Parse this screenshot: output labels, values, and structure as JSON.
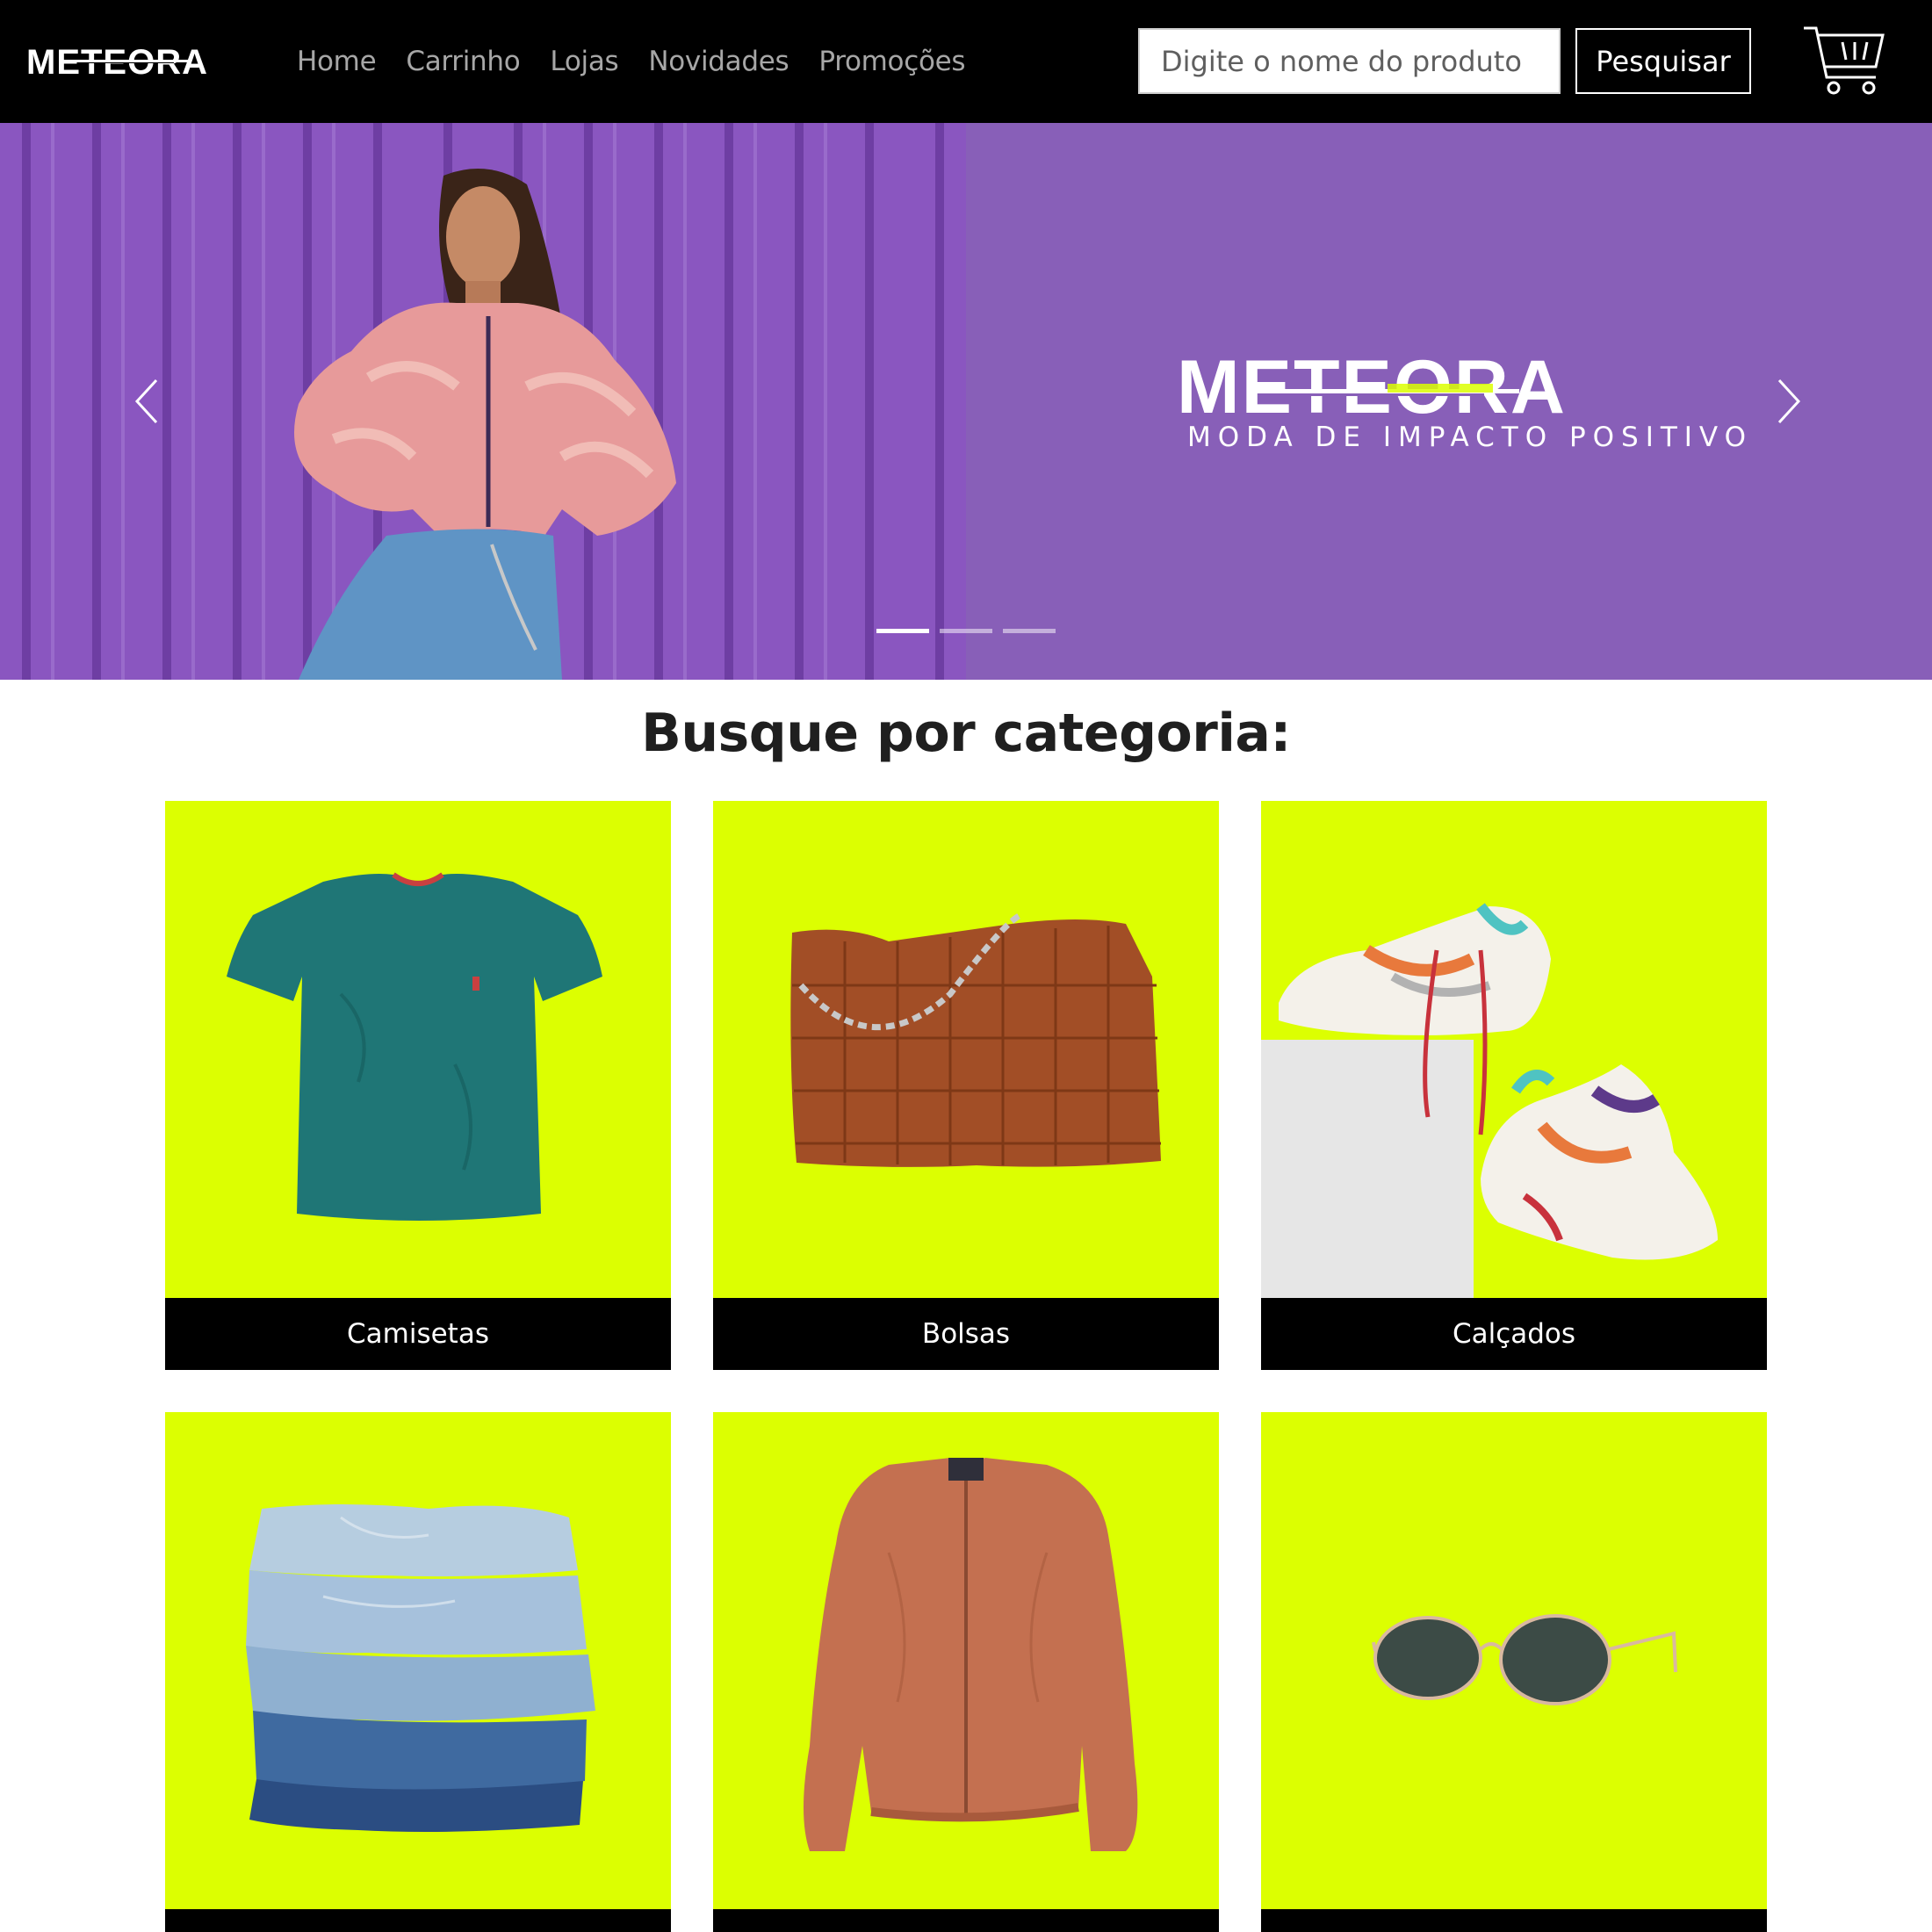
{
  "brand": {
    "name": "METEORA",
    "tagline": "MODA DE IMPACTO POSITIVO"
  },
  "nav": {
    "links": [
      "Home",
      "Carrinho",
      "Lojas",
      "Novidades",
      "Promoções"
    ]
  },
  "search": {
    "placeholder": "Digite o nome do produto",
    "button_label": "Pesquisar"
  },
  "carousel": {
    "slide_count": 3,
    "active_slide": 1
  },
  "categories": {
    "title": "Busque por categoria:",
    "items": [
      {
        "label": "Camisetas",
        "icon": "tshirt-image"
      },
      {
        "label": "Bolsas",
        "icon": "handbag-image"
      },
      {
        "label": "Calçados",
        "icon": "sneakers-image"
      },
      {
        "label": "",
        "icon": "jeans-image"
      },
      {
        "label": "",
        "icon": "jacket-image"
      },
      {
        "label": "",
        "icon": "sunglasses-image"
      }
    ]
  },
  "colors": {
    "navbar": "#000000",
    "hero": "#885fb8",
    "accent": "#dcff01",
    "card_label": "#000000"
  }
}
